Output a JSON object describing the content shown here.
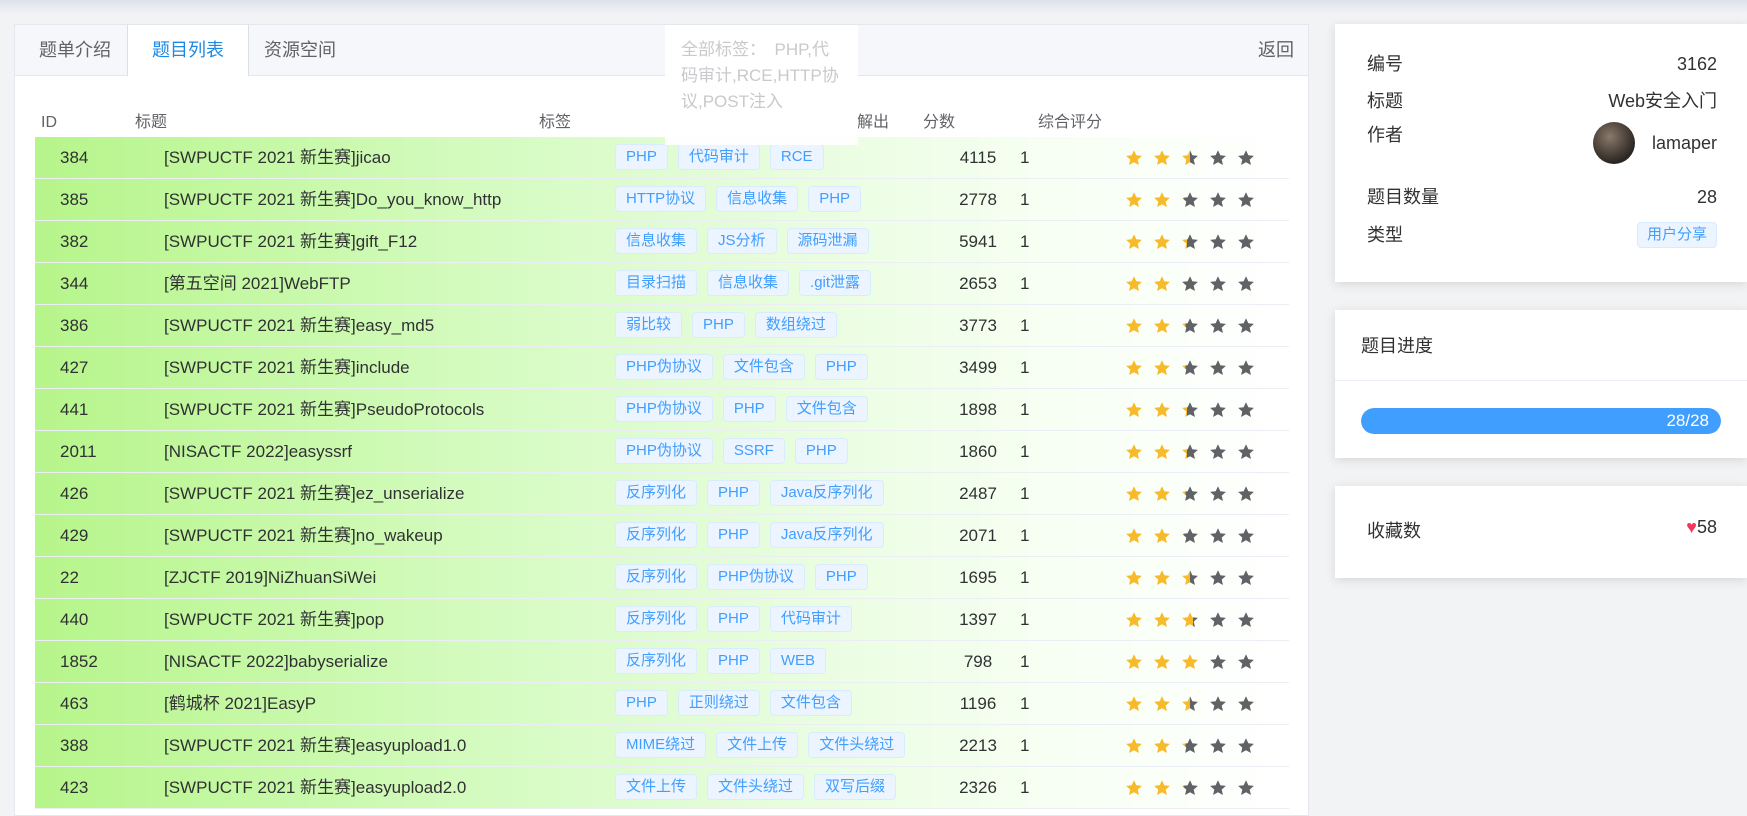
{
  "tabs": [
    "题单介绍",
    "题目列表",
    "资源空间"
  ],
  "back_label": "返回",
  "popover_text": "全部标签：　PHP,代码审计,RCE,HTTP协议,POST注入",
  "table": {
    "headers": {
      "id": "ID",
      "title": "标题",
      "tags": "标签",
      "solves": "解出",
      "score": "分数",
      "rating": "综合评分"
    },
    "rows": [
      {
        "id": "384",
        "title": "[SWPUCTF 2021 新生赛]jicao",
        "tags": [
          "PHP",
          "代码审计",
          "RCE"
        ],
        "solves": "4115",
        "score": "1",
        "rating": 2.5
      },
      {
        "id": "385",
        "title": "[SWPUCTF 2021 新生赛]Do_you_know_http",
        "tags": [
          "HTTP协议",
          "信息收集",
          "PHP"
        ],
        "solves": "2778",
        "score": "1",
        "rating": 2.1
      },
      {
        "id": "382",
        "title": "[SWPUCTF 2021 新生赛]gift_F12",
        "tags": [
          "信息收集",
          "JS分析",
          "源码泄漏"
        ],
        "solves": "5941",
        "score": "1",
        "rating": 2.3
      },
      {
        "id": "344",
        "title": "[第五空间 2021]WebFTP",
        "tags": [
          "目录扫描",
          "信息收集",
          ".git泄露"
        ],
        "solves": "2653",
        "score": "1",
        "rating": 2.0
      },
      {
        "id": "386",
        "title": "[SWPUCTF 2021 新生赛]easy_md5",
        "tags": [
          "弱比较",
          "PHP",
          "数组绕过"
        ],
        "solves": "3773",
        "score": "1",
        "rating": 2.2
      },
      {
        "id": "427",
        "title": "[SWPUCTF 2021 新生赛]include",
        "tags": [
          "PHP伪协议",
          "文件包含",
          "PHP"
        ],
        "solves": "3499",
        "score": "1",
        "rating": 2.2
      },
      {
        "id": "441",
        "title": "[SWPUCTF 2021 新生赛]PseudoProtocols",
        "tags": [
          "PHP伪协议",
          "PHP",
          "文件包含"
        ],
        "solves": "1898",
        "score": "1",
        "rating": 2.3
      },
      {
        "id": "2011",
        "title": "[NISACTF 2022]easyssrf",
        "tags": [
          "PHP伪协议",
          "SSRF",
          "PHP"
        ],
        "solves": "1860",
        "score": "1",
        "rating": 2.3
      },
      {
        "id": "426",
        "title": "[SWPUCTF 2021 新生赛]ez_unserialize",
        "tags": [
          "反序列化",
          "PHP",
          "Java反序列化"
        ],
        "solves": "2487",
        "score": "1",
        "rating": 2.2
      },
      {
        "id": "429",
        "title": "[SWPUCTF 2021 新生赛]no_wakeup",
        "tags": [
          "反序列化",
          "PHP",
          "Java反序列化"
        ],
        "solves": "2071",
        "score": "1",
        "rating": 2.1
      },
      {
        "id": "22",
        "title": "[ZJCTF 2019]NiZhuanSiWei",
        "tags": [
          "反序列化",
          "PHP伪协议",
          "PHP"
        ],
        "solves": "1695",
        "score": "1",
        "rating": 2.5
      },
      {
        "id": "440",
        "title": "[SWPUCTF 2021 新生赛]pop",
        "tags": [
          "反序列化",
          "PHP",
          "代码审计"
        ],
        "solves": "1397",
        "score": "1",
        "rating": 2.7
      },
      {
        "id": "1852",
        "title": "[NISACTF 2022]babyserialize",
        "tags": [
          "反序列化",
          "PHP",
          "WEB"
        ],
        "solves": "798",
        "score": "1",
        "rating": 3.0
      },
      {
        "id": "463",
        "title": "[鹤城杯 2021]EasyP",
        "tags": [
          "PHP",
          "正则绕过",
          "文件包含"
        ],
        "solves": "1196",
        "score": "1",
        "rating": 2.5
      },
      {
        "id": "388",
        "title": "[SWPUCTF 2021 新生赛]easyupload1.0",
        "tags": [
          "MIME绕过",
          "文件上传",
          "文件头绕过"
        ],
        "solves": "2213",
        "score": "1",
        "rating": 2.2
      },
      {
        "id": "423",
        "title": "[SWPUCTF 2021 新生赛]easyupload2.0",
        "tags": [
          "文件上传",
          "文件头绕过",
          "双写后缀"
        ],
        "solves": "2326",
        "score": "1",
        "rating": 2.1
      }
    ]
  },
  "info": {
    "id_label": "编号",
    "id_value": "3162",
    "title_label": "标题",
    "title_value": "Web安全入门",
    "author_label": "作者",
    "author_value": "lamaper",
    "count_label": "题目数量",
    "count_value": "28",
    "type_label": "类型",
    "type_value": "用户分享"
  },
  "progress": {
    "label": "题目进度",
    "text": "28/28",
    "fraction": 1.0
  },
  "favorites": {
    "label": "收藏数",
    "heart": "♥",
    "count": "58"
  },
  "colors": {
    "star_on": "#f7ba2a",
    "star_off": "#606266",
    "accent": "#409eff"
  }
}
